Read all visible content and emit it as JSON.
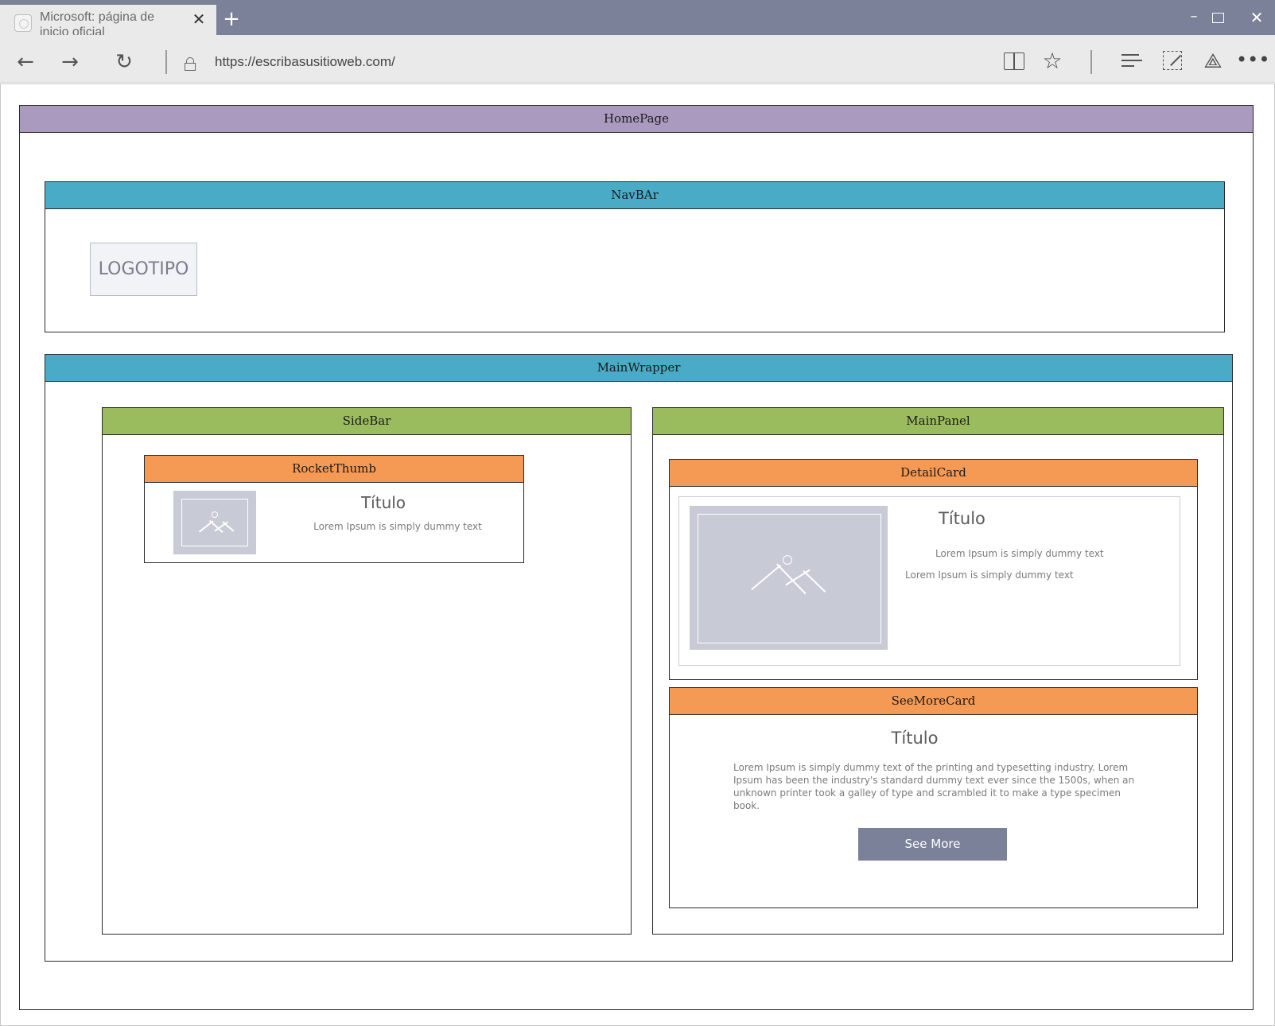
{
  "browser": {
    "tab_title": "Microsoft: página de inicio oficial",
    "url": "https://escribasusitioweb.com/",
    "icons": [
      "back-arrow-icon",
      "forward-arrow-icon",
      "refresh-icon",
      "lock-icon",
      "reading-view-icon",
      "favorite-star-icon",
      "hub-icon",
      "web-note-icon",
      "share-icon",
      "more-icon",
      "close-tab-icon",
      "new-tab-icon",
      "minimize-icon",
      "maximize-icon",
      "close-window-icon"
    ]
  },
  "diagram": {
    "homepage": "HomePage",
    "navbar": "NavBAr",
    "logo": "LOGOTIPO",
    "mainwrapper": "MainWrapper",
    "sidebar": "SideBar",
    "mainpanel": "MainPanel",
    "rocketthumb": {
      "label": "RocketThumb",
      "title": "Título",
      "text": "Lorem Ipsum is simply dummy text"
    },
    "detailcard": {
      "label": "DetailCard",
      "title": "Título",
      "text1": "Lorem Ipsum is simply dummy text",
      "text2": "Lorem Ipsum is simply dummy text"
    },
    "seemorecard": {
      "label": "SeeMoreCard",
      "title": "Título",
      "paragraph": "Lorem Ipsum is simply dummy text of the printing and typesetting industry. Lorem Ipsum has been the industry's standard dummy text ever since the 1500s, when an unknown printer took a galley of type and scrambled it to make a type specimen book.",
      "button": "See More"
    }
  },
  "colors": {
    "chrome": "#7b8198",
    "homepage_header": "#ab9ac0",
    "blue_header": "#4aabc7",
    "green_header": "#9bbb5f",
    "orange_header": "#f59a54",
    "button": "#7b8198",
    "image_placeholder": "#c8cbd6"
  }
}
